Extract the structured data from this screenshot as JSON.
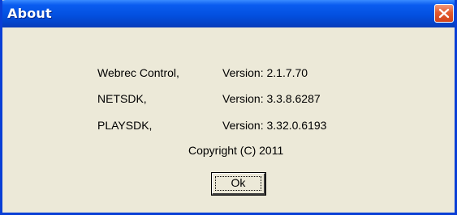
{
  "window": {
    "title": "About",
    "close_icon": "close-icon",
    "accent_color": "#0a3fd6"
  },
  "about": {
    "rows": [
      {
        "name": "Webrec Control,",
        "version": "Version: 2.1.7.70"
      },
      {
        "name": "NETSDK,",
        "version": "Version: 3.3.8.6287"
      },
      {
        "name": "PLAYSDK,",
        "version": "Version: 3.32.0.6193"
      }
    ],
    "copyright": "Copyright (C) 2011",
    "ok_label": "Ok"
  }
}
